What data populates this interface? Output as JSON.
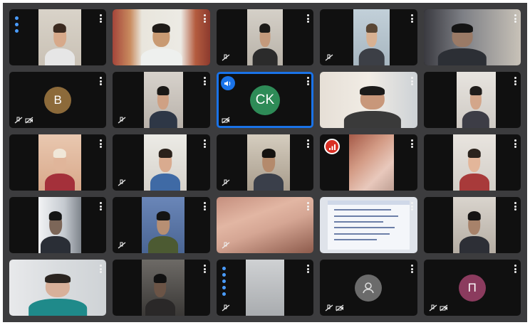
{
  "meeting": {
    "tiles": [
      {
        "kind": "video",
        "talking": true,
        "muted": false
      },
      {
        "kind": "video",
        "muted": false
      },
      {
        "kind": "video",
        "muted": true
      },
      {
        "kind": "video",
        "muted": true
      },
      {
        "kind": "video",
        "muted": false
      },
      {
        "kind": "avatar",
        "initial": "B",
        "color": "#8c6a3a",
        "muted": true
      },
      {
        "kind": "video",
        "muted": true
      },
      {
        "kind": "avatar",
        "initial": "CK",
        "color": "#2e8b57",
        "muted": true,
        "active": true,
        "badge": "speaker"
      },
      {
        "kind": "video",
        "muted": false
      },
      {
        "kind": "video",
        "muted": false
      },
      {
        "kind": "video",
        "muted": false
      },
      {
        "kind": "video",
        "muted": true
      },
      {
        "kind": "video",
        "muted": true
      },
      {
        "kind": "video",
        "muted": false,
        "badge": "signal"
      },
      {
        "kind": "video",
        "muted": false
      },
      {
        "kind": "video",
        "muted": false
      },
      {
        "kind": "video",
        "muted": true
      },
      {
        "kind": "video",
        "muted": true
      },
      {
        "kind": "screenshare",
        "muted": false
      },
      {
        "kind": "video",
        "muted": false
      },
      {
        "kind": "video",
        "muted": false
      },
      {
        "kind": "video",
        "muted": false
      },
      {
        "kind": "video",
        "talking": true,
        "muted": true
      },
      {
        "kind": "avatar",
        "initial": "",
        "color": "#6b6b6b",
        "muted": true,
        "generic": true
      },
      {
        "kind": "avatar",
        "initial": "П",
        "color": "#8b3b5e",
        "muted": true
      }
    ]
  },
  "colors": {
    "grid_bg": "#3c3c3e",
    "tile_bg": "#101010",
    "active_border": "#1a73e8",
    "talking_dot": "#4a9cff",
    "badge_red": "#d93025"
  }
}
